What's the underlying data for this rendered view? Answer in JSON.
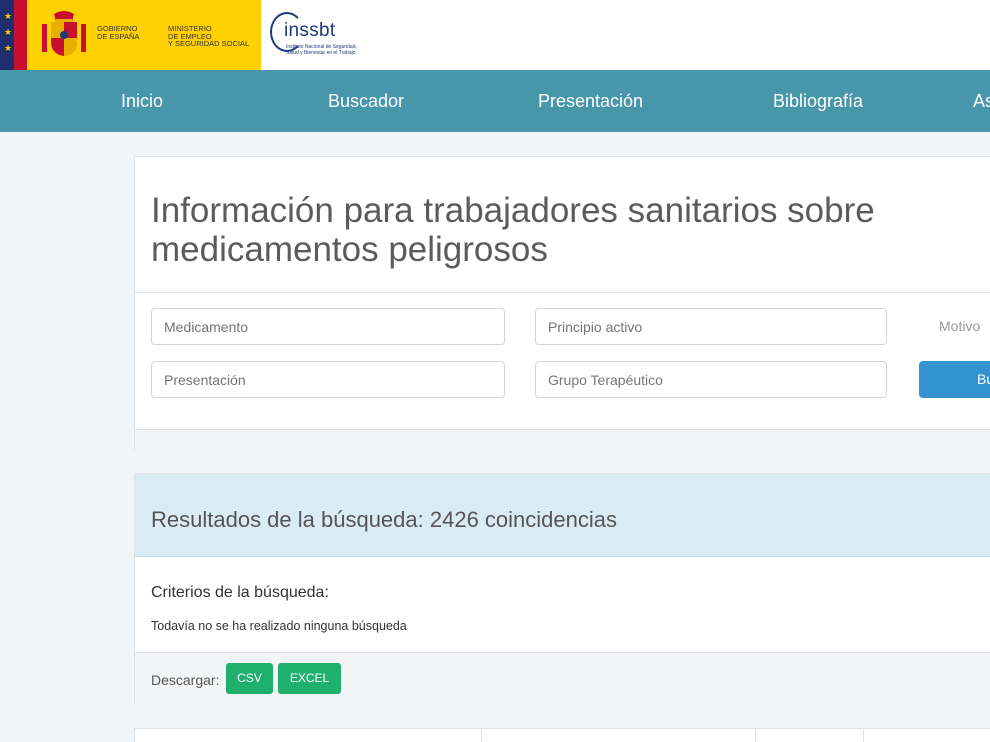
{
  "header": {
    "gov_line1": "GOBIERNO",
    "gov_line2": "DE ESPAÑA",
    "min_line1": "MINISTERIO",
    "min_line2": "DE EMPLEO",
    "min_line3": "Y SEGURIDAD SOCIAL",
    "inssbt_name": "inssbt",
    "inssbt_sub1": "Instituto Nacional de Seguridad,",
    "inssbt_sub2": "Salud y Bienestar en el Trabajo",
    "brand_colors": {
      "yellow": "#ffd100",
      "navy": "#1e3a7b",
      "red": "#c8102e"
    }
  },
  "nav": {
    "items": [
      "Inicio",
      "Buscador",
      "Presentación",
      "Bibliografía",
      "As"
    ],
    "color": "#4796aa"
  },
  "search": {
    "title": "Información para trabajadores sanitarios sobre medicamentos peligrosos",
    "medicamento_placeholder": "Medicamento",
    "principio_placeholder": "Principio activo",
    "presentacion_placeholder": "Presentación",
    "grupo_placeholder": "Grupo Terapéutico",
    "motivo_label": "Motivo",
    "buscar_label": "Buscar",
    "accent": "#3393d0"
  },
  "results": {
    "title": "Resultados de la búsqueda: 2426 coincidencias",
    "criteria_title": "Criterios de la búsqueda:",
    "criteria_text": "Todavía no se ha realizado ninguna búsqueda",
    "download_label": "Descargar:",
    "csv_label": "CSV",
    "excel_label": "EXCEL",
    "button_color": "#1fb06e"
  }
}
